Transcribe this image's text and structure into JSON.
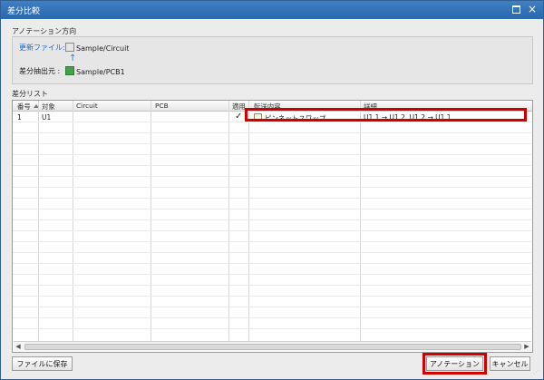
{
  "window": {
    "title": "差分比較"
  },
  "annotation_direction": {
    "heading": "アノテーション方向",
    "update_file_label": "更新ファイル:",
    "update_file_value": "Sample/Circuit",
    "source_label": "差分抽出元 :",
    "source_value": "Sample/PCB1"
  },
  "diff_list": {
    "heading": "差分リスト",
    "columns": [
      "番号",
      "対象",
      "Circuit",
      "PCB",
      "適用",
      "転送内容",
      "詳細"
    ],
    "rows": [
      {
        "number": "1",
        "target": "U1",
        "circuit": "",
        "pcb": "",
        "applied": "✓",
        "transfer": "ピンネットスワップ",
        "detail": "U1.1 → U1.2, U1.2 → U1.1"
      }
    ]
  },
  "buttons": {
    "save_to_file": "ファイルに保存",
    "annotation": "アノテーション",
    "cancel": "キャンセル"
  },
  "colors": {
    "titlebar": "#2a67ad",
    "highlight": "#d00000",
    "link": "#1f66c9"
  }
}
